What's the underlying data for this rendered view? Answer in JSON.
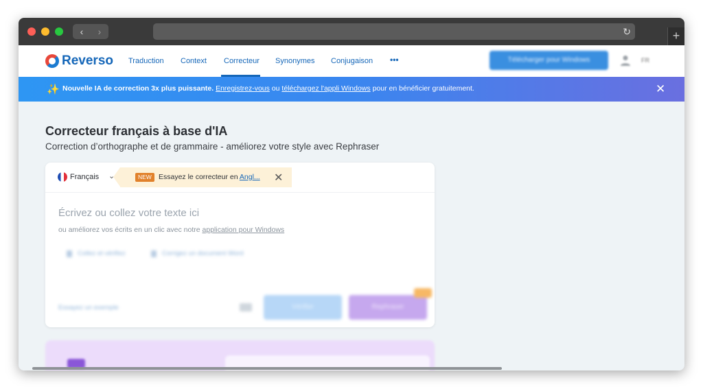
{
  "browser": {
    "controls": [
      "close-dot",
      "minimize-dot",
      "maximize-dot"
    ],
    "back_icon": "‹",
    "forward_icon": "›",
    "reload_icon": "↻",
    "newtab_icon": "+"
  },
  "header": {
    "logo_text": "Reverso",
    "nav": [
      "Traduction",
      "Context",
      "Correcteur",
      "Synonymes",
      "Conjugaison",
      "•••"
    ],
    "active": "Correcteur",
    "download_label": "Télécharger pour Windows",
    "lang_short": "FR"
  },
  "banner": {
    "strong": "Nouvelle IA de correction 3x plus puissante.",
    "link1": "Enregistrez-vous",
    "mid": "ou",
    "link2": "téléchargez l'appli Windows",
    "end": "pour en bénéficier gratuitement.",
    "close": "✕"
  },
  "main": {
    "title": "Correcteur français à base d'IA",
    "subtitle": "Correction d’orthographe et de grammaire - améliorez votre style avec Rephraser"
  },
  "editor": {
    "language": "Français",
    "promo_badge": "NEW",
    "promo_text": "Essayez le correcteur en",
    "promo_link": "Angl...",
    "placeholder": "Écrivez ou collez votre texte ici",
    "hint_text": "ou améliorez vos écrits en un clic avec notre",
    "hint_link": "application pour Windows",
    "paste_label": "Collez et vérifiez",
    "word_label": "Corrigez un document Word",
    "example_label": "Essayez un exemple",
    "correct_label": "Vérifier",
    "rephrase_label": "Rephraser"
  },
  "colors": {
    "brand_blue": "#1466b8",
    "banner_start": "#2e96f3",
    "banner_end": "#6a6fe0",
    "promo_bg": "#fdf1d8",
    "new_badge": "#e1812b"
  }
}
